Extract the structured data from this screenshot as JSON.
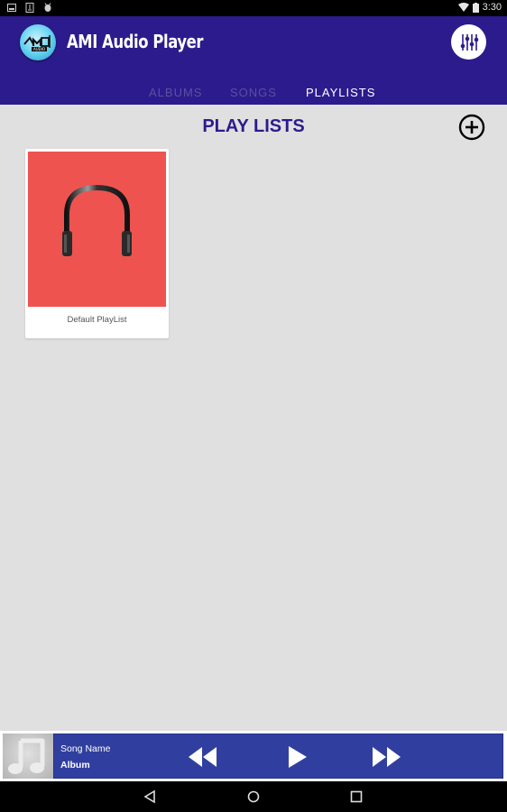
{
  "status_bar": {
    "left_icons": [
      "image-notification-icon",
      "download-notification-icon",
      "android-debug-icon"
    ],
    "right_icons": [
      "wifi-icon",
      "battery-icon"
    ],
    "time": "3:30"
  },
  "app_bar": {
    "title": "AMI Audio Player",
    "logo_icon": "ami-audio-logo-icon",
    "equalizer_icon": "equalizer-icon",
    "tabs": [
      {
        "label": "ALBUMS",
        "active": false
      },
      {
        "label": "SONGS",
        "active": false
      },
      {
        "label": "PLAYLISTS",
        "active": true
      }
    ]
  },
  "main": {
    "section_title": "PLAY LISTS",
    "add_icon": "add-circle-icon",
    "playlists": [
      {
        "name": "Default PlayList",
        "art_icon": "headphones-icon",
        "art_color": "#ef5350"
      }
    ]
  },
  "player": {
    "song_name": "Song Name",
    "album": "Album",
    "thumb_icon": "music-note-icon",
    "controls": [
      "rewind-icon",
      "play-icon",
      "fast-forward-icon"
    ]
  },
  "nav_bar": {
    "buttons": [
      "back-icon",
      "home-icon",
      "recents-icon"
    ]
  },
  "colors": {
    "primary": "#2c1b8c",
    "player_bar": "#303f9f",
    "background": "#e0e0e0",
    "tab_inactive": "#5d4f9e",
    "tab_active": "#ffffff"
  }
}
